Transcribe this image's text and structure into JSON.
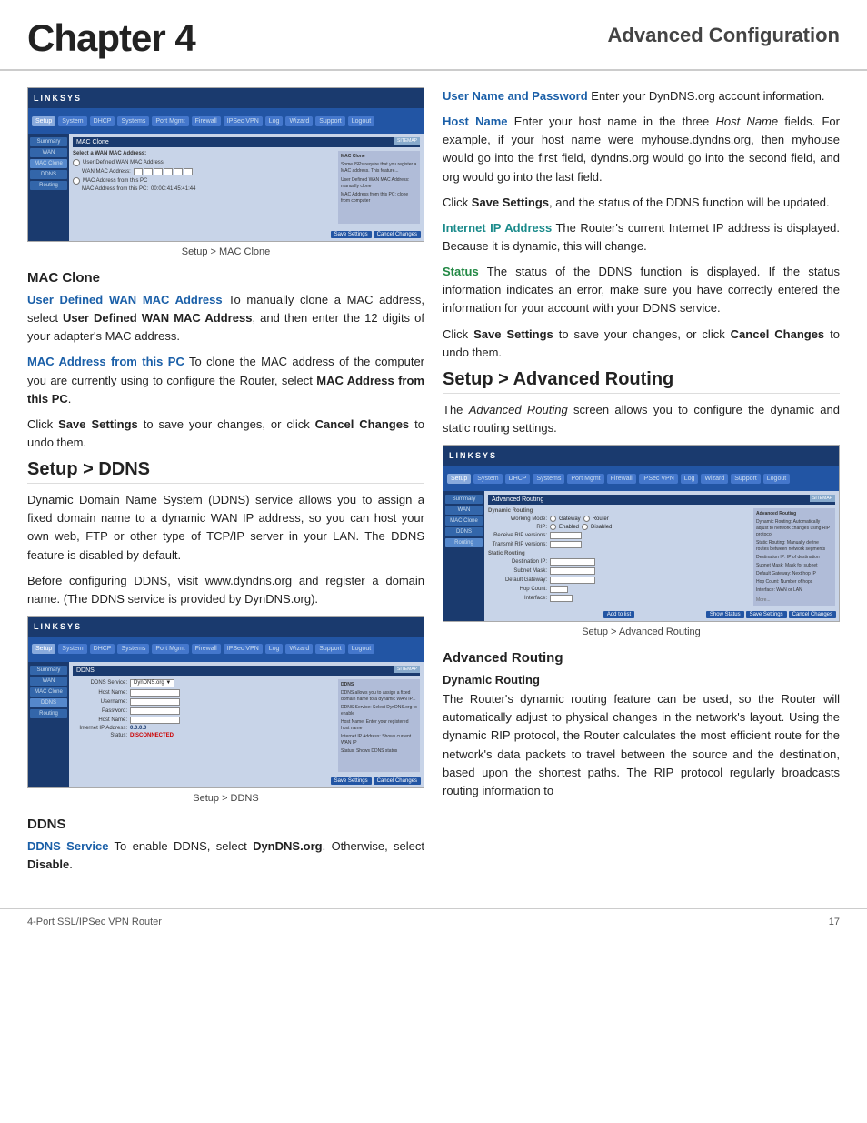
{
  "header": {
    "chapter": "Chapter 4",
    "title": "Advanced Configuration"
  },
  "footer": {
    "product": "4-Port SSL/IPSec VPN Router",
    "page": "17"
  },
  "left_column": {
    "mac_clone_screenshot_caption": "Setup > MAC Clone",
    "mac_clone_section": {
      "heading": "MAC Clone",
      "user_defined_wan": "User Defined WAN MAC Address",
      "user_defined_wan_text": " To manually clone a MAC address, select ",
      "user_defined_wan_bold": "User Defined WAN MAC Address",
      "user_defined_wan_text2": ", and then enter the 12 digits of your adapter's MAC address.",
      "mac_address_from_pc": "MAC Address from this PC",
      "mac_address_text": " To clone the MAC address of the computer you are currently using to configure the Router, select ",
      "mac_address_bold": "MAC Address from this PC",
      "mac_address_text2": ".",
      "save_settings_text": "Click ",
      "save_settings_bold": "Save Settings",
      "save_settings_text2": " to save your changes, or click ",
      "cancel_changes_bold": "Cancel Changes",
      "save_settings_text3": " to undo them."
    },
    "ddns_screenshot_caption": "Setup > DDNS",
    "ddns_section": {
      "heading": "Setup > DDNS",
      "intro": "Dynamic Domain Name System (DDNS) service allows you to assign a fixed domain name to a dynamic WAN IP address, so you can host your own web, FTP or other type of TCP/IP server in your LAN. The DDNS feature is disabled by default.",
      "before_config": "Before configuring DDNS, visit www.dyndns.org and register a domain name. (The DDNS service is provided by DynDNS.org).",
      "ddns_subsection": {
        "heading": "DDNS",
        "ddns_service": "DDNS Service",
        "ddns_service_text": " To enable DDNS, select ",
        "ddns_service_bold": "DynDNS.org",
        "ddns_service_text2": ". Otherwise, select ",
        "disable_bold": "Disable",
        "disable_text2": "."
      }
    }
  },
  "right_column": {
    "user_name_password": "User Name and Password",
    "user_name_text": " Enter your DynDNS.org account information.",
    "host_name": "Host Name",
    "host_name_text": "  Enter your host name in the three ",
    "host_name_italic": "Host Name",
    "host_name_text2": " fields. For example, if your host name were myhouse.dyndns.org, then myhouse would go into the first field, dyndns.org would go into the second field, and org would go into the last field.",
    "save_settings_1_text": "Click ",
    "save_settings_1_bold": "Save Settings",
    "save_settings_1_text2": ", and the status of the DDNS function will be updated.",
    "internet_ip": "Internet IP Address",
    "internet_ip_text": " The Router's current Internet IP address is displayed. Because it is dynamic, this will change.",
    "status": "Status",
    "status_text": " The status of the DDNS function is displayed. If the status information indicates an error, make sure you have correctly entered the information for your account with your DDNS service.",
    "save_settings_2_text": "Click ",
    "save_settings_2_bold": "Save Settings",
    "save_settings_2_text2": " to save your changes, or click ",
    "cancel_changes_bold": "Cancel Changes",
    "save_settings_2_text3": " to undo them.",
    "advanced_routing_heading": "Setup > Advanced Routing",
    "advanced_routing_screenshot_caption": "Setup > Advanced Routing",
    "advanced_routing_intro": "The ",
    "advanced_routing_italic": "Advanced Routing",
    "advanced_routing_text": " screen allows you to configure the dynamic and static routing settings.",
    "advanced_routing_section": {
      "heading": "Advanced Routing",
      "dynamic_routing_subheading": "Dynamic Routing",
      "dynamic_routing_text": "The Router's dynamic routing feature can be used, so the Router will automatically adjust to physical changes in the network's layout. Using the dynamic RIP protocol, the Router calculates the most efficient route for the network's data packets to travel between the source and the destination, based upon the shortest paths. The RIP protocol regularly broadcasts routing information to"
    }
  }
}
